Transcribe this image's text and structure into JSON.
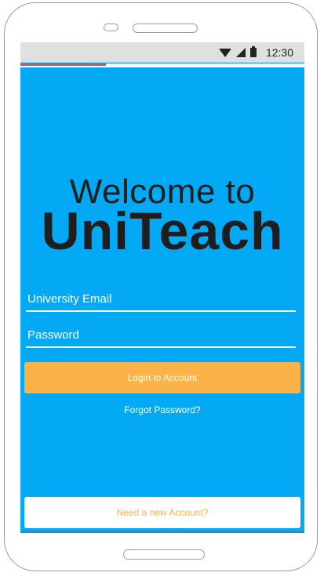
{
  "status_bar": {
    "time": "12:30",
    "icons": [
      "wifi-icon",
      "signal-icon",
      "battery-icon"
    ]
  },
  "progress": {
    "fraction": 0.3
  },
  "hero": {
    "welcome": "Welcome to",
    "brand": "UniTeach"
  },
  "form": {
    "email_placeholder": "University Email",
    "password_placeholder": "Password",
    "login_label": "Login to Account",
    "forgot_label": "Forgot Password?"
  },
  "footer": {
    "new_account_label": "Need a new Account?"
  },
  "colors": {
    "screen_background": "#03a9f4",
    "primary_button": "#fbb349",
    "progress_fill": "#d0545d",
    "text_dark": "#1e1e1e"
  }
}
